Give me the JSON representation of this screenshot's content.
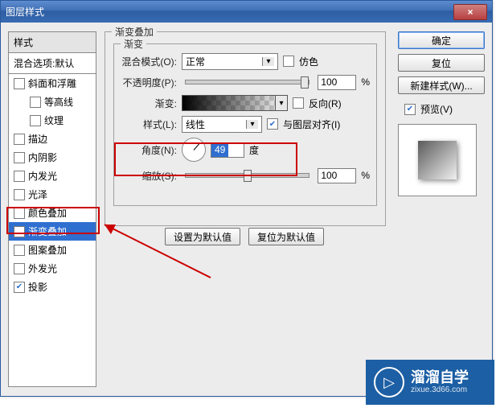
{
  "window": {
    "title": "图层样式",
    "close": "×"
  },
  "styles": {
    "header": "样式",
    "sub": "混合选项:默认",
    "items": [
      {
        "key": "bevel",
        "label": "斜面和浮雕",
        "checked": false,
        "indent": false
      },
      {
        "key": "contour",
        "label": "等高线",
        "checked": false,
        "indent": true
      },
      {
        "key": "texture",
        "label": "纹理",
        "checked": false,
        "indent": true
      },
      {
        "key": "stroke",
        "label": "描边",
        "checked": false,
        "indent": false
      },
      {
        "key": "innershadow",
        "label": "内阴影",
        "checked": false,
        "indent": false
      },
      {
        "key": "innerglow",
        "label": "内发光",
        "checked": false,
        "indent": false
      },
      {
        "key": "satin",
        "label": "光泽",
        "checked": false,
        "indent": false
      },
      {
        "key": "coloroverlay",
        "label": "颜色叠加",
        "checked": false,
        "indent": false
      },
      {
        "key": "gradoverlay",
        "label": "渐变叠加",
        "checked": true,
        "indent": false,
        "active": true
      },
      {
        "key": "patternoverlay",
        "label": "图案叠加",
        "checked": false,
        "indent": false
      },
      {
        "key": "outerglow",
        "label": "外发光",
        "checked": false,
        "indent": false
      },
      {
        "key": "dropshadow",
        "label": "投影",
        "checked": true,
        "indent": false
      }
    ]
  },
  "panel": {
    "group_title": "渐变叠加",
    "inner_title": "渐变",
    "blend_label": "混合模式(O):",
    "blend_value": "正常",
    "dither_label": "仿色",
    "opacity_label": "不透明度(P):",
    "opacity_value": "100",
    "pct": "%",
    "gradient_label": "渐变:",
    "reverse_label": "反向(R)",
    "style_label": "样式(L):",
    "style_value": "线性",
    "align_label": "与图层对齐(I)",
    "angle_label": "角度(N):",
    "angle_value": "49",
    "angle_unit": "度",
    "scale_label": "缩放(S):",
    "scale_value": "100"
  },
  "defaults": {
    "set": "设置为默认值",
    "reset": "复位为默认值"
  },
  "right": {
    "ok": "确定",
    "cancel": "复位",
    "new_style": "新建样式(W)...",
    "preview": "预览(V)"
  },
  "watermark": {
    "big": "溜溜自学",
    "small": "zixue.3d66.com",
    "glyph": "▷"
  }
}
